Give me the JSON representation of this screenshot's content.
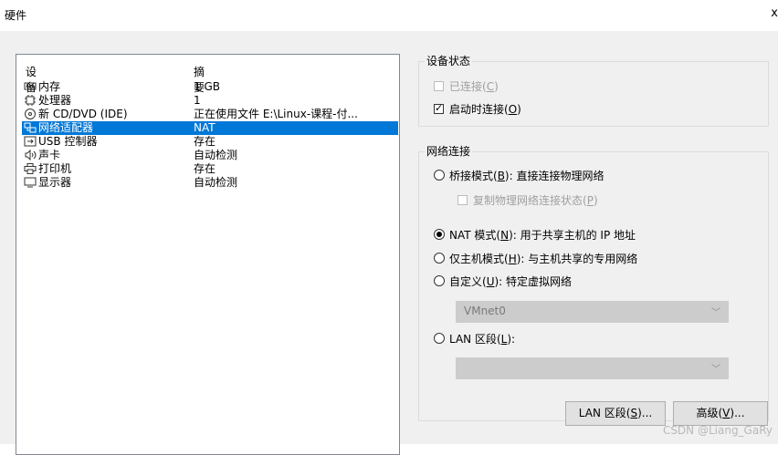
{
  "window": {
    "title": "硬件"
  },
  "device_list": {
    "col_device": "设备",
    "col_summary": "摘要",
    "rows": [
      {
        "icon": "memory-icon",
        "name": "内存",
        "summary": "1 GB",
        "selected": false
      },
      {
        "icon": "processor-icon",
        "name": "处理器",
        "summary": "1",
        "selected": false
      },
      {
        "icon": "cd-dvd-icon",
        "name": "新 CD/DVD (IDE)",
        "summary": "正在使用文件 E:\\Linux-课程-付...",
        "selected": false
      },
      {
        "icon": "network-adapter-icon",
        "name": "网络适配器",
        "summary": "NAT",
        "selected": true
      },
      {
        "icon": "usb-icon",
        "name": "USB 控制器",
        "summary": "存在",
        "selected": false
      },
      {
        "icon": "speaker-icon",
        "name": "声卡",
        "summary": "自动检测",
        "selected": false
      },
      {
        "icon": "printer-icon",
        "name": "打印机",
        "summary": "存在",
        "selected": false
      },
      {
        "icon": "monitor-icon",
        "name": "显示器",
        "summary": "自动检测",
        "selected": false
      }
    ]
  },
  "device_status": {
    "title": "设备状态",
    "connected": {
      "text": "已连接(",
      "key": "C",
      "tail": ")",
      "checked": false,
      "enabled": false
    },
    "connect_at_power_on": {
      "text": "启动时连接(",
      "key": "O",
      "tail": ")",
      "checked": true,
      "enabled": true
    }
  },
  "network_connection": {
    "title": "网络连接",
    "bridged": {
      "text": "桥接模式(",
      "key": "B",
      "tail": "): 直接连接物理网络",
      "selected": false
    },
    "replicate": {
      "text": "复制物理网络连接状态(",
      "key": "P",
      "tail": ")",
      "checked": false,
      "enabled": false
    },
    "nat": {
      "text": "NAT 模式(",
      "key": "N",
      "tail": "): 用于共享主机的 IP 地址",
      "selected": true
    },
    "host_only": {
      "text": "仅主机模式(",
      "key": "H",
      "tail": "): 与主机共享的专用网络",
      "selected": false
    },
    "custom": {
      "text": "自定义(",
      "key": "U",
      "tail": "): 特定虚拟网络",
      "selected": false
    },
    "vmnet_value": "VMnet0",
    "lan_segment": {
      "text": "LAN 区段(",
      "key": "L",
      "tail": "):",
      "selected": false
    },
    "lan_value": ""
  },
  "buttons": {
    "lan_segments": {
      "text": "LAN 区段(",
      "key": "S",
      "tail": ")..."
    },
    "advanced": {
      "text": "高级(",
      "key": "V",
      "tail": ")..."
    }
  },
  "watermark": "CSDN @Liang_GaRy",
  "colors": {
    "selection": "#0078d7",
    "dialog_bg": "#f0f0f0"
  }
}
